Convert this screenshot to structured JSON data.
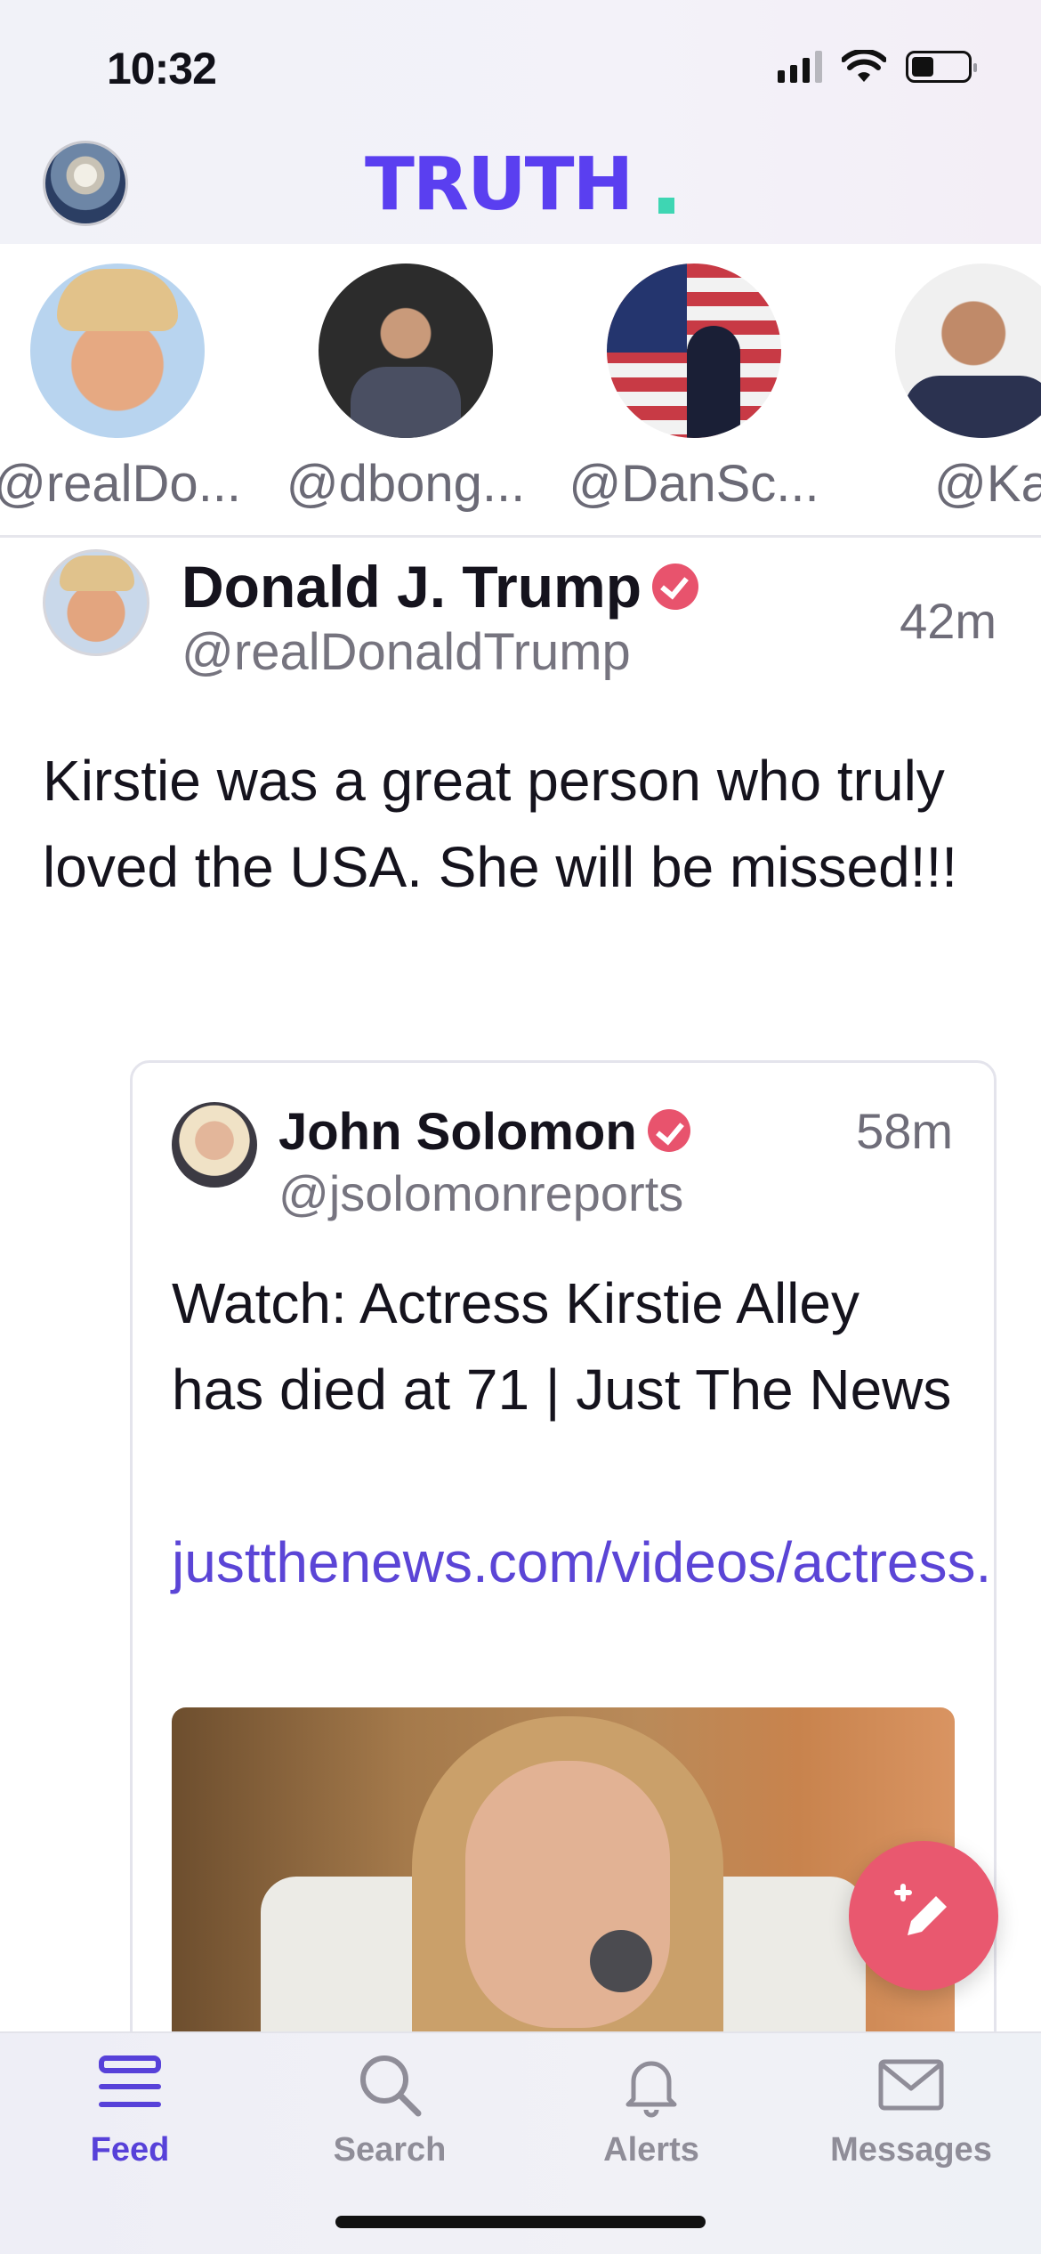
{
  "status_bar": {
    "time": "10:32"
  },
  "header": {
    "logo_text": "TRUTH",
    "brand_color": "#5a3ff0",
    "accent_dot_color": "#3ed6b3"
  },
  "stories": [
    {
      "handle": "@realDo..."
    },
    {
      "handle": "@dbong..."
    },
    {
      "handle": "@DanSc..."
    },
    {
      "handle": "@Ka"
    }
  ],
  "post": {
    "author_name": "Donald J. Trump",
    "author_handle": "@realDonaldTrump",
    "time": "42m",
    "text": "Kirstie was a great person who truly loved the USA. She will be missed!!!",
    "quote": {
      "author_name": "John Solomon",
      "author_handle": "@jsolomonreports",
      "time": "58m",
      "text": "Watch: Actress Kirstie Alley has died at 71 | Just The News",
      "link": "justthenews.com/videos/actress..."
    }
  },
  "tabbar": {
    "tabs": [
      {
        "label": "Feed",
        "icon": "feed-icon",
        "active": true
      },
      {
        "label": "Search",
        "icon": "search-icon",
        "active": false
      },
      {
        "label": "Alerts",
        "icon": "bell-icon",
        "active": false
      },
      {
        "label": "Messages",
        "icon": "envelope-icon",
        "active": false
      }
    ]
  },
  "colors": {
    "verified_badge": "#e8536d",
    "link": "#5b45d6",
    "compose_button": "#e9586f",
    "active_tab": "#5741d9"
  }
}
